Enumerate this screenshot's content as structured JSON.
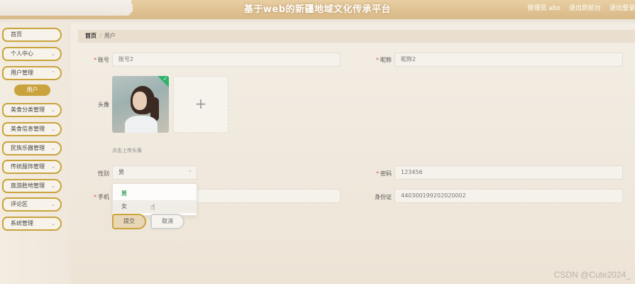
{
  "header": {
    "title": "基于web的新疆地域文化传承平台",
    "admin_label": "管理员 abo",
    "backend_link": "退出到前台",
    "logout_link": "退出登录"
  },
  "sidebar": {
    "items": [
      {
        "label": "首页",
        "has_chevron": false
      },
      {
        "label": "个人中心",
        "has_chevron": true
      },
      {
        "label": "用户管理",
        "has_chevron": true
      },
      {
        "label": "美食分类管理",
        "has_chevron": true
      },
      {
        "label": "美食信息管理",
        "has_chevron": true
      },
      {
        "label": "民族乐器管理",
        "has_chevron": true
      },
      {
        "label": "传统服饰管理",
        "has_chevron": true
      },
      {
        "label": "旅游胜地管理",
        "has_chevron": true
      },
      {
        "label": "评论区",
        "has_chevron": true
      },
      {
        "label": "系统管理",
        "has_chevron": true
      }
    ],
    "sub_item": "用户",
    "accent": "#c9a33c"
  },
  "breadcrumb": {
    "home": "首页",
    "sep": "/",
    "current": "用户"
  },
  "form": {
    "account_label": "账号",
    "account_value": "账号2",
    "nickname_label": "昵称",
    "nickname_value": "昵称2",
    "avatar_label": "头像",
    "upload_hint": "点击上传头像",
    "upload_plus": "+",
    "gender_label": "性别",
    "gender_value": "男",
    "gender_options": [
      "男",
      "女"
    ],
    "password_label": "密码",
    "password_value": "123456",
    "phone_label": "手机",
    "idcard_label": "身份证",
    "idcard_value": "440300199202020002",
    "submit_label": "提交",
    "cancel_label": "取消"
  },
  "watermark": "CSDN @Cute2024_"
}
